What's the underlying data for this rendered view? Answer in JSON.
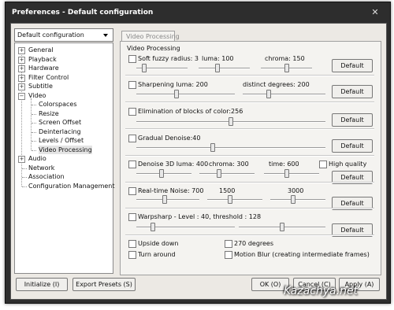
{
  "window": {
    "title": "Preferences - Default configuration",
    "close_glyph": "✕"
  },
  "config_combo": {
    "value": "Default configuration"
  },
  "tree": {
    "items": [
      {
        "label": "General",
        "expander": "+"
      },
      {
        "label": "Playback",
        "expander": "+"
      },
      {
        "label": "Hardware",
        "expander": "+"
      },
      {
        "label": "Filter Control",
        "expander": "+"
      },
      {
        "label": "Subtitle",
        "expander": "+"
      },
      {
        "label": "Video",
        "expander": "−"
      },
      {
        "label": "Colorspaces"
      },
      {
        "label": "Resize"
      },
      {
        "label": "Screen Offset"
      },
      {
        "label": "Deinterlacing"
      },
      {
        "label": "Levels / Offset"
      },
      {
        "label": "Video Processing",
        "selected": true
      },
      {
        "label": "Audio",
        "expander": "+"
      },
      {
        "label": "Network"
      },
      {
        "label": "Association"
      },
      {
        "label": "Configuration Management"
      }
    ]
  },
  "tab": {
    "label": "Video Processing"
  },
  "group_title": "Video Processing",
  "panel": {
    "soft_fuzzy": "Soft fuzzy radius: 3",
    "soft_luma": "luma: 100",
    "soft_chroma": "chroma: 150",
    "sharpening": "Sharpening luma: 200",
    "sharpening_distinct": "distinct degrees: 200",
    "elimination": "Elimination of blocks of color:256",
    "gradual": "Gradual Denoise:40",
    "denoise3d": "Denoise 3D luma: 400",
    "denoise_chroma": "chroma: 300",
    "denoise_time": "time: 600",
    "high_quality": "High quality",
    "realtime": "Real-time Noise: 700",
    "realtime_1500": "1500",
    "realtime_3000": "3000",
    "warpsharp": "Warpsharp - Level : 40, threshold : 128",
    "upside_down": "Upside down",
    "turn_around": "Turn around",
    "deg270": "270 degrees",
    "motion_blur": "Motion Blur (creating intermediate frames)",
    "default_label": "Default"
  },
  "sliders": {
    "soft_radius": 0.12,
    "soft_luma": 0.35,
    "soft_chroma": 0.5,
    "sharpening_luma": 0.4,
    "sharpening_distinct": 0.3,
    "elimination": 0.5,
    "gradual": 0.4,
    "denoise_luma": 0.45,
    "denoise_chroma": 0.35,
    "denoise_time": 0.4,
    "realtime_a": 0.45,
    "realtime_b": 0.4,
    "realtime_c": 0.4,
    "warp_level": 0.15,
    "warp_threshold": 0.5
  },
  "footer": {
    "initialize": "Initialize (I)",
    "export_presets": "Export Presets (S)",
    "ok": "OK (O)",
    "cancel": "Cancel (C)",
    "apply": "Apply (A)"
  },
  "watermark": "Kazachya.net"
}
